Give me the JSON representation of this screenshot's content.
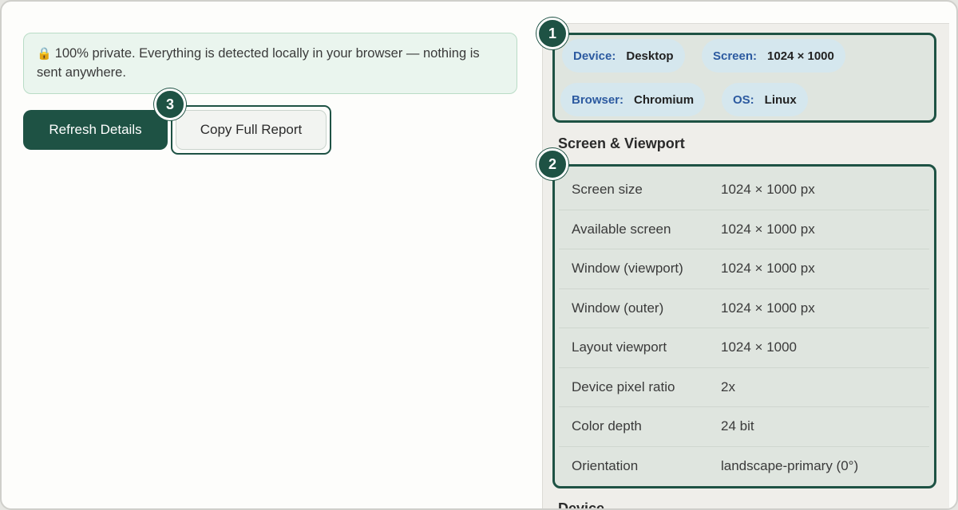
{
  "notice": {
    "icon": "lock-icon",
    "text": "100% private. Everything is detected locally in your browser — nothing is sent anywhere."
  },
  "buttons": {
    "refresh_label": "Refresh Details",
    "copy_label": "Copy Full Report"
  },
  "markers": [
    "1",
    "2",
    "3"
  ],
  "chips": [
    {
      "key": "Device:",
      "value": "Desktop"
    },
    {
      "key": "Screen:",
      "value": "1024 × 1000"
    },
    {
      "key": "Browser:",
      "value": "Chromium"
    },
    {
      "key": "OS:",
      "value": "Linux"
    }
  ],
  "sections": {
    "screen_title": "Screen & Viewport",
    "device_title": "Device"
  },
  "screen_rows": [
    {
      "label": "Screen size",
      "value": "1024 × 1000 px"
    },
    {
      "label": "Available screen",
      "value": "1024 × 1000 px"
    },
    {
      "label": "Window (viewport)",
      "value": "1024 × 1000 px"
    },
    {
      "label": "Window (outer)",
      "value": "1024 × 1000 px"
    },
    {
      "label": "Layout viewport",
      "value": "1024 × 1000"
    },
    {
      "label": "Device pixel ratio",
      "value": "2x"
    },
    {
      "label": "Color depth",
      "value": "24 bit"
    },
    {
      "label": "Orientation",
      "value": "landscape-primary (0°)"
    }
  ],
  "colors": {
    "accent": "#1e5244",
    "chip_bg": "#d5e7ee",
    "chip_key": "#2c5aa0",
    "notice_bg": "#eaf5ee"
  }
}
